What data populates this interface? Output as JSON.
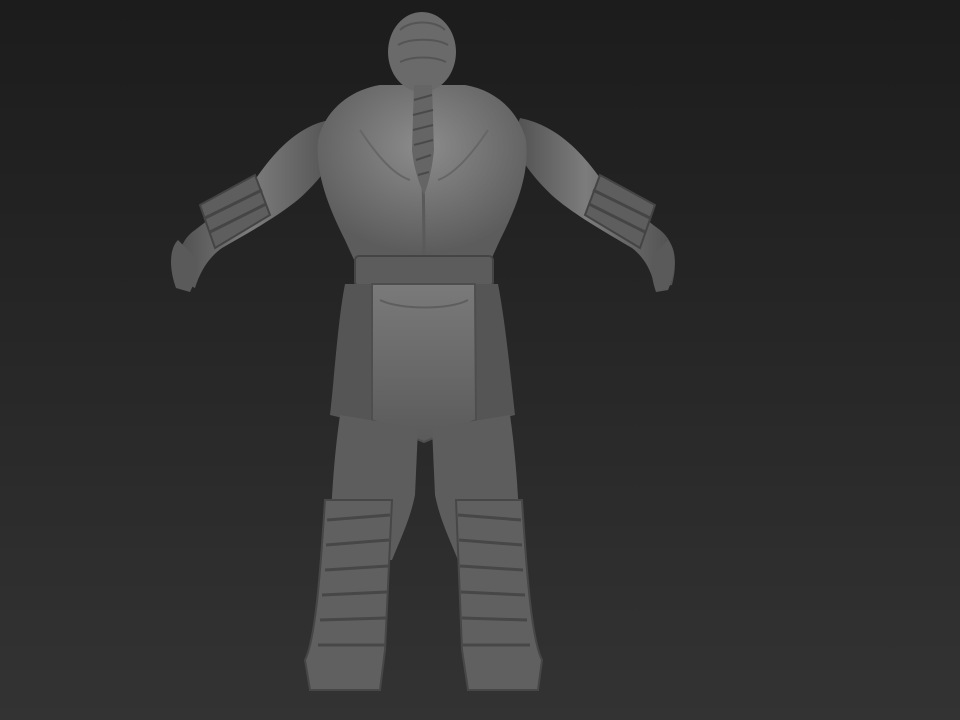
{
  "viewport": {
    "background_top": "#1c1c1c",
    "background_bottom": "#333333"
  },
  "model": {
    "subject": "sculpted-warrior-back-view",
    "clay_color": "#6e6e6e",
    "clay_light": "#8a8a8a",
    "clay_dark": "#4a4a4a"
  }
}
